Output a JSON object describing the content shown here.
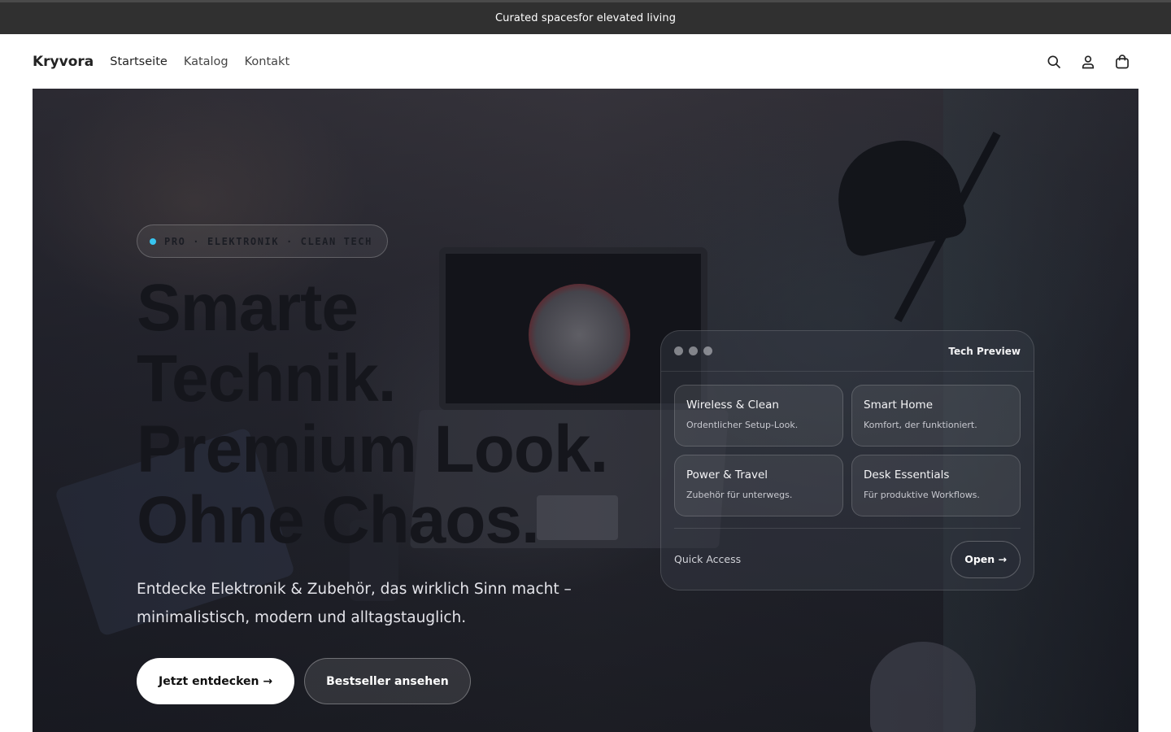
{
  "announcement": "Curated spacesfor elevated living",
  "header": {
    "logo": "Kryvora",
    "nav": [
      "Startseite",
      "Katalog",
      "Kontakt"
    ],
    "icons": [
      "search-icon",
      "account-icon",
      "cart-icon"
    ]
  },
  "hero": {
    "tagline": "PRO · ELEKTRONIK · CLEAN TECH",
    "headline": [
      "Smarte",
      "Technik.",
      "Premium Look.",
      "Ohne Chaos."
    ],
    "subline": "Entdecke Elektronik & Zubehör, das wirklich Sinn macht – minimalistisch, modern und alltagstauglich.",
    "primary_cta": "Jetzt entdecken →",
    "secondary_cta": "Bestseller ansehen"
  },
  "panel": {
    "title": "Tech Preview",
    "cards": [
      {
        "title": "Wireless & Clean",
        "sub": "Ordentlicher Setup-Look."
      },
      {
        "title": "Smart Home",
        "sub": "Komfort, der funktioniert."
      },
      {
        "title": "Power & Travel",
        "sub": "Zubehör für unterwegs."
      },
      {
        "title": "Desk Essentials",
        "sub": "Für produktive Workflows."
      }
    ],
    "quick_access": "Quick Access",
    "open_label": "Open →"
  },
  "colors": {
    "announce_bg": "#303030",
    "tag_dot": "#37c5f0",
    "headline": "#15161c"
  }
}
